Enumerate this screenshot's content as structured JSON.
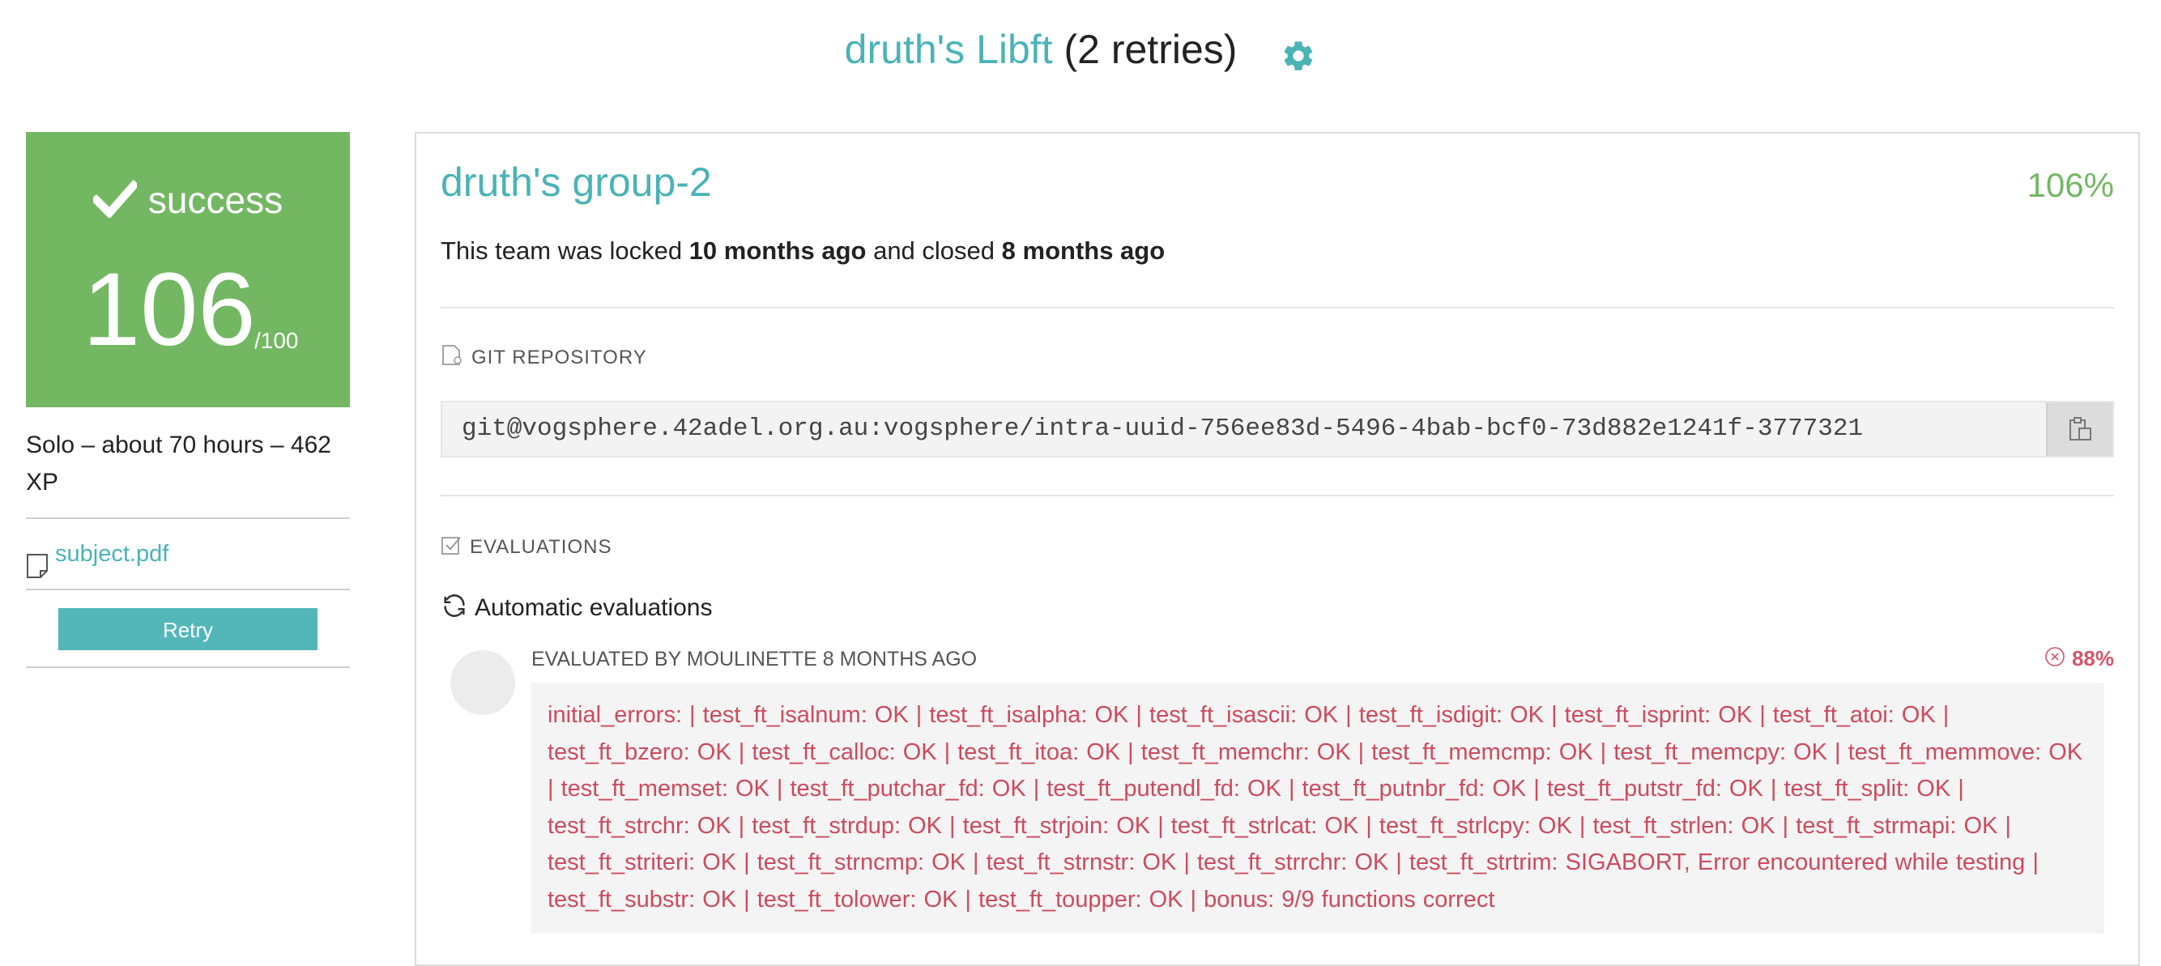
{
  "header": {
    "project_owner_name": "druth's Libft",
    "retries": "(2 retries)",
    "settings_icon": "gear-icon"
  },
  "left": {
    "status": "success",
    "score": "106",
    "score_max": "/100",
    "meta": "Solo – about 70 hours – 462 XP",
    "subject_link": "subject.pdf",
    "retry_label": "Retry",
    "colors": {
      "success": "#73b763",
      "accent": "#4ab3b6"
    }
  },
  "main": {
    "group_title": "druth's group-2",
    "percent": "106%",
    "locked_prefix": "This team was locked",
    "locked_time": "10 months ago",
    "closed_prefix": "and closed",
    "closed_time": "8 months ago",
    "git_label": "GIT REPOSITORY",
    "git_url": "git@vogsphere.42adel.org.au:vogsphere/intra-uuid-756ee83d-5496-4bab-bcf0-73d882e1241f-3777321",
    "evaluations_label": "EVALUATIONS",
    "auto_evaluations_label": "Automatic evaluations",
    "evaluation": {
      "evaluator_line": "EVALUATED BY MOULINETTE 8 MONTHS AGO",
      "percent": "88%",
      "result": "initial_errors: | test_ft_isalnum: OK | test_ft_isalpha: OK | test_ft_isascii: OK | test_ft_isdigit: OK | test_ft_isprint: OK | test_ft_atoi: OK | test_ft_bzero: OK | test_ft_calloc: OK | test_ft_itoa: OK | test_ft_memchr: OK | test_ft_memcmp: OK | test_ft_memcpy: OK | test_ft_memmove: OK | test_ft_memset: OK | test_ft_putchar_fd: OK | test_ft_putendl_fd: OK | test_ft_putnbr_fd: OK | test_ft_putstr_fd: OK | test_ft_split: OK | test_ft_strchr: OK | test_ft_strdup: OK | test_ft_strjoin: OK | test_ft_strlcat: OK | test_ft_strlcpy: OK | test_ft_strlen: OK | test_ft_strmapi: OK | test_ft_striteri: OK | test_ft_strncmp: OK | test_ft_strnstr: OK | test_ft_strrchr: OK | test_ft_strtrim: SIGABORT, Error encountered while testing | test_ft_substr: OK | test_ft_tolower: OK | test_ft_toupper: OK | bonus: 9/9 functions correct"
    }
  }
}
